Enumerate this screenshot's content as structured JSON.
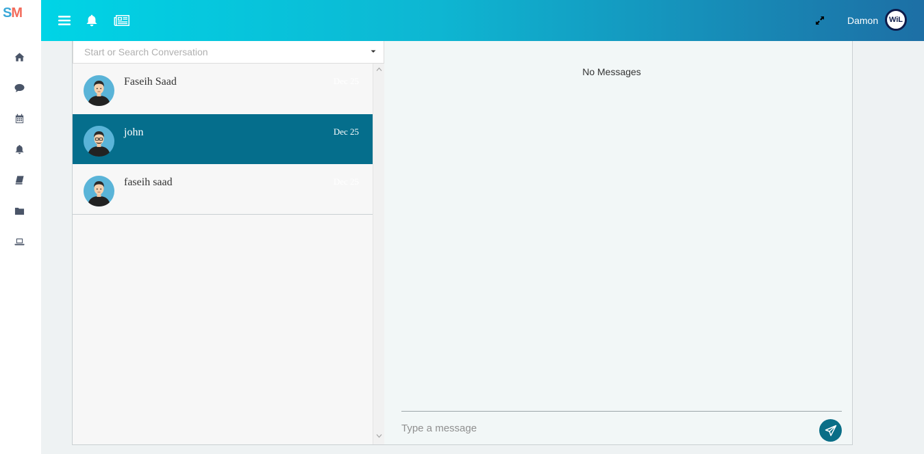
{
  "app": {
    "logo": {
      "s": "S",
      "m": "M"
    }
  },
  "header": {
    "user_name": "Damon",
    "avatar_initials": "WiL"
  },
  "sidebar": {
    "items": [
      {
        "icon": "home-icon"
      },
      {
        "icon": "chat-icon"
      },
      {
        "icon": "calendar-icon"
      },
      {
        "icon": "bell-icon"
      },
      {
        "icon": "book-icon"
      },
      {
        "icon": "folder-icon"
      },
      {
        "icon": "laptop-icon"
      }
    ]
  },
  "search": {
    "placeholder": "Start or Search Conversation",
    "value": ""
  },
  "conversations": [
    {
      "name": "Faseih Saad",
      "date": "Dec 25",
      "active": false
    },
    {
      "name": "john",
      "date": "Dec 25",
      "active": true
    },
    {
      "name": "faseih saad",
      "date": "Dec 25",
      "active": false
    }
  ],
  "messages": {
    "empty_text": "No Messages",
    "input_placeholder": "Type a message",
    "input_value": ""
  },
  "colors": {
    "accent": "#056e8c",
    "header_start": "#00d4e6",
    "header_end": "#1d6fa5",
    "logo_s": "#3aa8d8",
    "logo_m": "#f26b5b"
  }
}
